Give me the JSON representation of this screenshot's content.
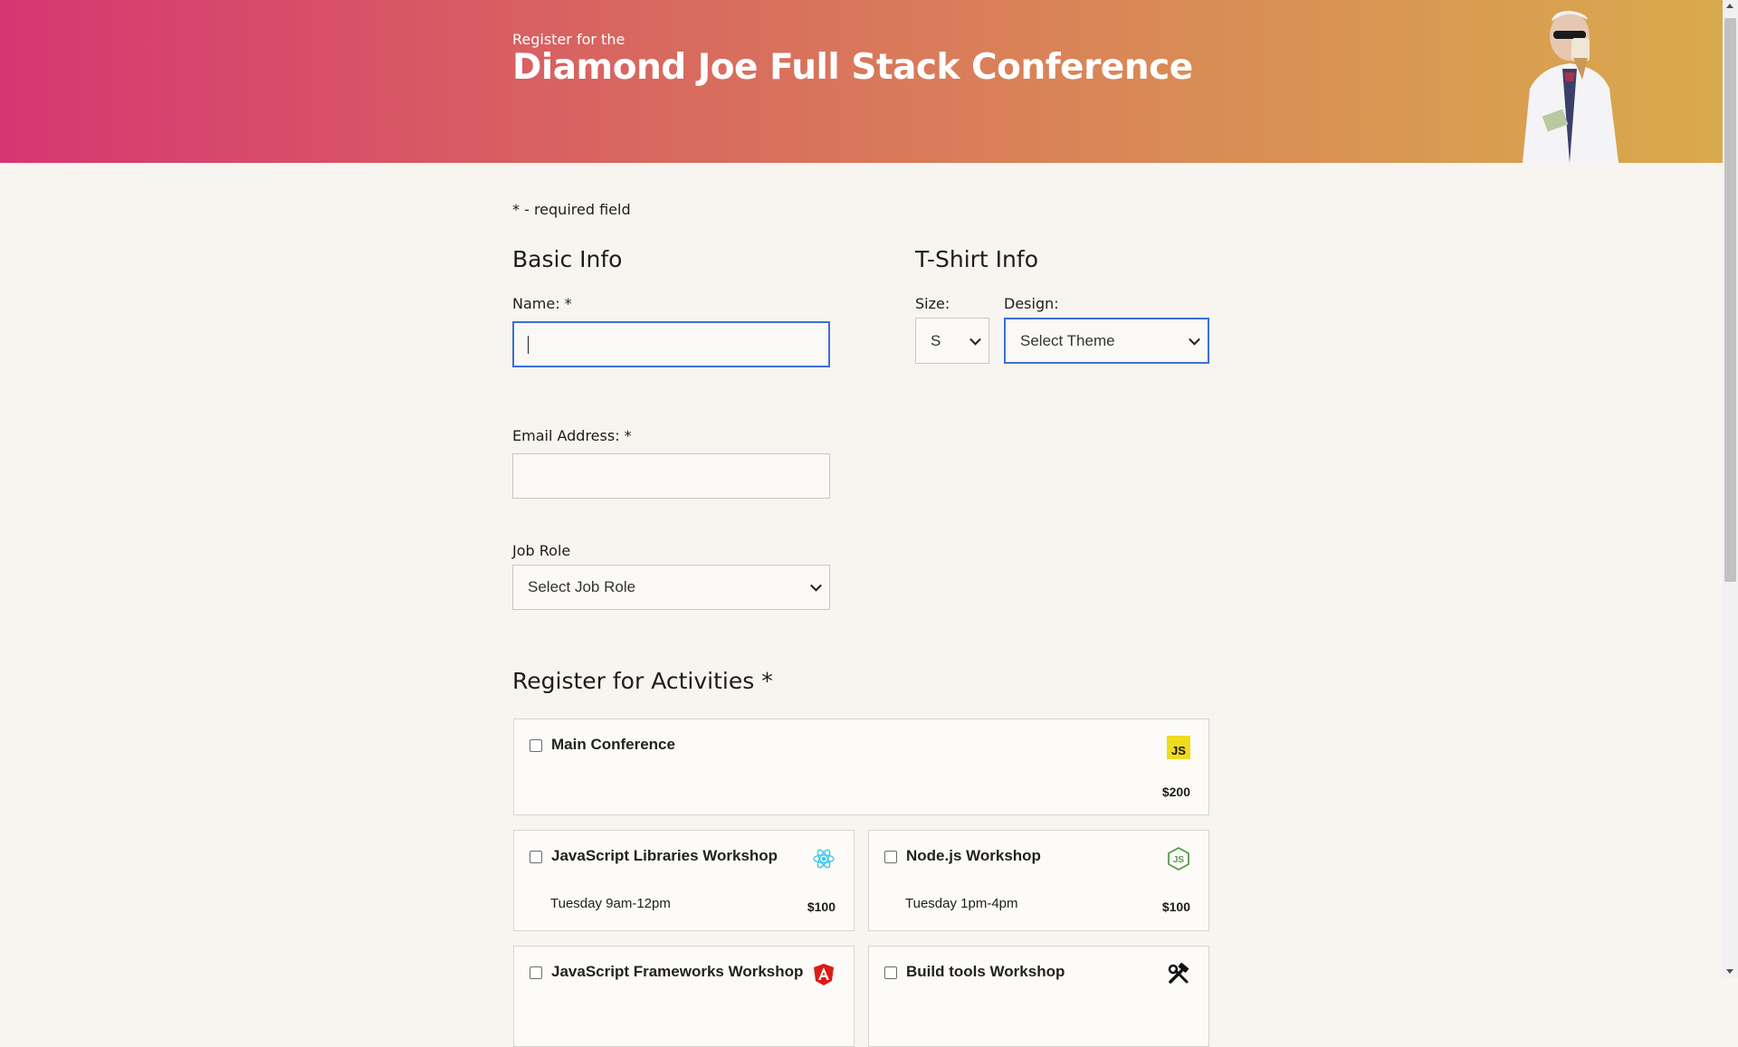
{
  "header": {
    "pre_title": "Register for the",
    "title": "Diamond Joe Full Stack Conference"
  },
  "required_note": "* - required field",
  "basic_info": {
    "heading": "Basic Info",
    "name_label": "Name: *",
    "name_value": "",
    "email_label": "Email Address: *",
    "email_value": "",
    "job_role_label": "Job Role",
    "job_role_selected": "Select Job Role"
  },
  "tshirt_info": {
    "heading": "T-Shirt Info",
    "size_label": "Size:",
    "size_selected": "S",
    "design_label": "Design:",
    "design_selected": "Select Theme"
  },
  "activities": {
    "heading": "Register for Activities *",
    "items": [
      {
        "name": "Main Conference",
        "time": "",
        "price": "$200",
        "icon": "javascript-icon"
      },
      {
        "name": "JavaScript Libraries Workshop",
        "time": "Tuesday 9am-12pm",
        "price": "$100",
        "icon": "react-icon"
      },
      {
        "name": "Node.js Workshop",
        "time": "Tuesday 1pm-4pm",
        "price": "$100",
        "icon": "nodejs-icon"
      },
      {
        "name": "JavaScript Frameworks Workshop",
        "time": "",
        "price": "",
        "icon": "angular-icon"
      },
      {
        "name": "Build tools Workshop",
        "time": "",
        "price": "",
        "icon": "tools-icon"
      }
    ]
  },
  "colors": {
    "header_gradient_start": "#d63672",
    "header_gradient_end": "#d9aa4d",
    "focus_border": "#3b6fd8",
    "page_bg": "#f8f4ef"
  }
}
